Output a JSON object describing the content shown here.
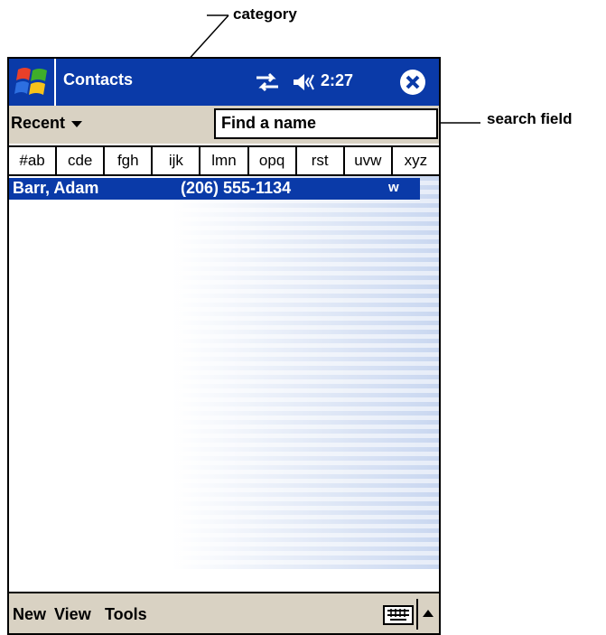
{
  "callouts": {
    "category": "category",
    "search_field": "search field"
  },
  "titlebar": {
    "app_title": "Contacts",
    "clock": "2:27"
  },
  "toolbar": {
    "category_value": "Recent",
    "search_placeholder": "Find a name"
  },
  "alpha_tabs": [
    "#ab",
    "cde",
    "fgh",
    "ijk",
    "lmn",
    "opq",
    "rst",
    "uvw",
    "xyz"
  ],
  "contacts": [
    {
      "name": "Barr, Adam",
      "phone": "(206) 555-1134",
      "type": "w"
    }
  ],
  "menubar": {
    "new_label": "New",
    "view_label": "View",
    "tools_label": "Tools"
  },
  "icons": {
    "start": "windows-flag-icon",
    "connectivity": "connectivity-icon",
    "volume": "speaker-icon",
    "close": "close-icon",
    "keyboard": "keyboard-icon",
    "sip_menu": "up-arrow-icon"
  },
  "colors": {
    "titlebar": "#0a3aa8",
    "toolbar": "#d9d2c3",
    "selection": "#0a3aa8"
  }
}
